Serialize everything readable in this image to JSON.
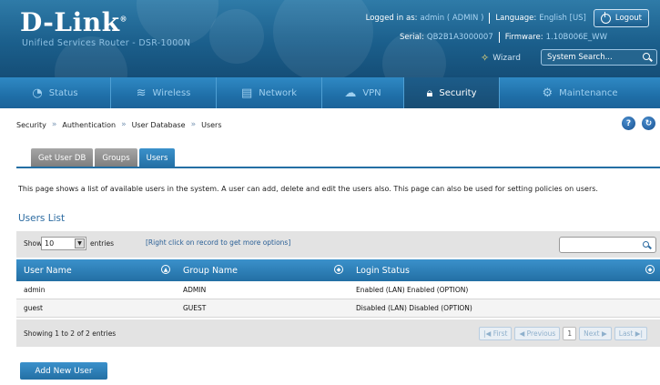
{
  "header": {
    "logo": "D-Link",
    "logo_mark": "®",
    "product": "Unified Services Router - DSR-1000N",
    "logged_in_label": "Logged in as:",
    "logged_in_value": "admin ( ADMIN )",
    "language_label": "Language:",
    "language_value": "English [US]",
    "logout": "Logout",
    "serial_label": "Serial:",
    "serial_value": "QB2B1A3000007",
    "firmware_label": "Firmware:",
    "firmware_value": "1.10B006E_WW",
    "wizard": "Wizard",
    "search_placeholder": "System Search..."
  },
  "nav": [
    {
      "label": "Status",
      "icon": "gauge-icon",
      "active": false
    },
    {
      "label": "Wireless",
      "icon": "wifi-icon",
      "active": false
    },
    {
      "label": "Network",
      "icon": "monitor-icon",
      "active": false
    },
    {
      "label": "VPN",
      "icon": "cloud-icon",
      "active": false
    },
    {
      "label": "Security",
      "icon": "lock-icon",
      "active": true
    },
    {
      "label": "Maintenance",
      "icon": "gears-icon",
      "active": false
    }
  ],
  "breadcrumb": [
    "Security",
    "Authentication",
    "User Database",
    "Users"
  ],
  "tabs": [
    {
      "label": "Get User DB",
      "active": false
    },
    {
      "label": "Groups",
      "active": false
    },
    {
      "label": "Users",
      "active": true
    }
  ],
  "description": "This page shows a list of available users in the system. A user can add, delete and edit the users also. This page can also be used for setting policies on users.",
  "list_title": "Users List",
  "table": {
    "show_label": "Show",
    "entries_value": "10",
    "entries_label": "entries",
    "hint": "[Right click on record to get more options]",
    "columns": [
      "User Name",
      "Group Name",
      "Login Status"
    ],
    "rows": [
      [
        "admin",
        "ADMIN",
        "Enabled (LAN) Enabled (OPTION)"
      ],
      [
        "guest",
        "GUEST",
        "Disabled (LAN) Disabled (OPTION)"
      ]
    ],
    "showing": "Showing 1 to 2 of 2 entries",
    "pager": {
      "first": "First",
      "previous": "Previous",
      "page": "1",
      "next": "Next",
      "last": "Last"
    }
  },
  "add_button": "Add New User",
  "colors": {
    "accent": "#236fa4",
    "header": "#1b5f8c",
    "nav": "#1f6fa8"
  }
}
